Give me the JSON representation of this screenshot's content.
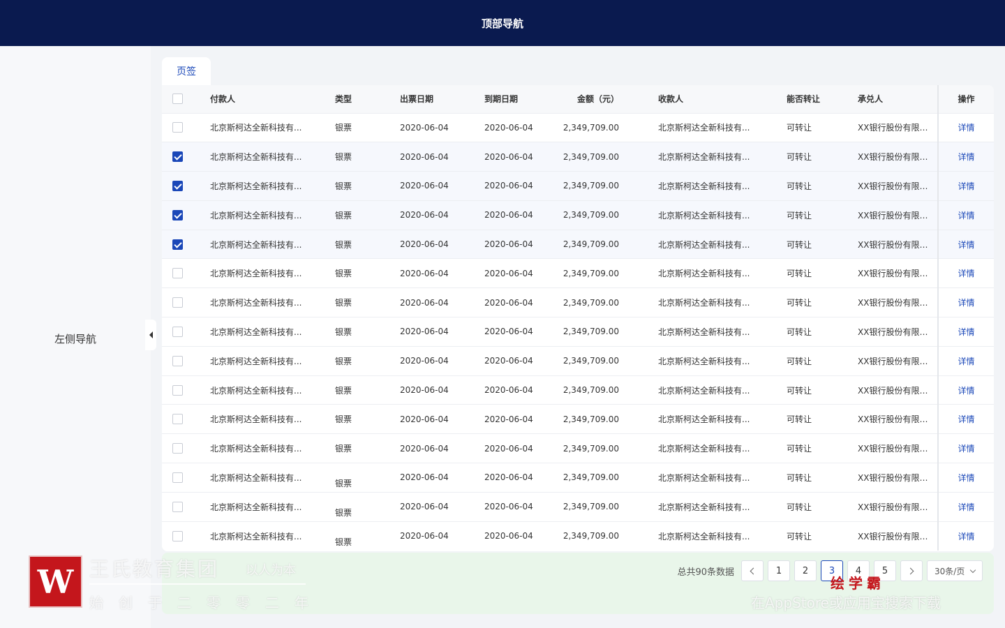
{
  "top_nav": {
    "title": "顶部导航"
  },
  "sidebar": {
    "title": "左侧导航"
  },
  "tab": {
    "label": "页签"
  },
  "table": {
    "headers": {
      "payer": "付款人",
      "type": "类型",
      "issue_date": "出票日期",
      "due_date": "到期日期",
      "amount": "金额（元）",
      "payee": "收款人",
      "transferable": "能否转让",
      "acceptor": "承兑人",
      "operation": "操作"
    },
    "rows": [
      {
        "checked": false,
        "payer": "北京斯柯达全新科技有...",
        "type": "银票",
        "issue_date": "2020-06-04",
        "due_date": "2020-06-04",
        "amount": "2,349,709.00",
        "payee": "北京斯柯达全新科技有...",
        "transferable": "可转让",
        "acceptor": "XX银行股份有限公司...",
        "action": "详情"
      },
      {
        "checked": true,
        "payer": "北京斯柯达全新科技有...",
        "type": "银票",
        "issue_date": "2020-06-04",
        "due_date": "2020-06-04",
        "amount": "2,349,709.00",
        "payee": "北京斯柯达全新科技有...",
        "transferable": "可转让",
        "acceptor": "XX银行股份有限公司...",
        "action": "详情"
      },
      {
        "checked": true,
        "payer": "北京斯柯达全新科技有...",
        "type": "银票",
        "issue_date": "2020-06-04",
        "due_date": "2020-06-04",
        "amount": "2,349,709.00",
        "payee": "北京斯柯达全新科技有...",
        "transferable": "可转让",
        "acceptor": "XX银行股份有限公司...",
        "action": "详情"
      },
      {
        "checked": true,
        "payer": "北京斯柯达全新科技有...",
        "type": "银票",
        "issue_date": "2020-06-04",
        "due_date": "2020-06-04",
        "amount": "2,349,709.00",
        "payee": "北京斯柯达全新科技有...",
        "transferable": "可转让",
        "acceptor": "XX银行股份有限公司...",
        "action": "详情"
      },
      {
        "checked": true,
        "payer": "北京斯柯达全新科技有...",
        "type": "银票",
        "issue_date": "2020-06-04",
        "due_date": "2020-06-04",
        "amount": "2,349,709.00",
        "payee": "北京斯柯达全新科技有...",
        "transferable": "可转让",
        "acceptor": "XX银行股份有限公司...",
        "action": "详情"
      },
      {
        "checked": false,
        "payer": "北京斯柯达全新科技有...",
        "type": "银票",
        "issue_date": "2020-06-04",
        "due_date": "2020-06-04",
        "amount": "2,349,709.00",
        "payee": "北京斯柯达全新科技有...",
        "transferable": "可转让",
        "acceptor": "XX银行股份有限公司...",
        "action": "详情"
      },
      {
        "checked": false,
        "payer": "北京斯柯达全新科技有...",
        "type": "银票",
        "issue_date": "2020-06-04",
        "due_date": "2020-06-04",
        "amount": "2,349,709.00",
        "payee": "北京斯柯达全新科技有...",
        "transferable": "可转让",
        "acceptor": "XX银行股份有限公司...",
        "action": "详情"
      },
      {
        "checked": false,
        "payer": "北京斯柯达全新科技有...",
        "type": "银票",
        "issue_date": "2020-06-04",
        "due_date": "2020-06-04",
        "amount": "2,349,709.00",
        "payee": "北京斯柯达全新科技有...",
        "transferable": "可转让",
        "acceptor": "XX银行股份有限公司...",
        "action": "详情"
      },
      {
        "checked": false,
        "payer": "北京斯柯达全新科技有...",
        "type": "银票",
        "issue_date": "2020-06-04",
        "due_date": "2020-06-04",
        "amount": "2,349,709.00",
        "payee": "北京斯柯达全新科技有...",
        "transferable": "可转让",
        "acceptor": "XX银行股份有限公司...",
        "action": "详情"
      },
      {
        "checked": false,
        "payer": "北京斯柯达全新科技有...",
        "type": "银票",
        "issue_date": "2020-06-04",
        "due_date": "2020-06-04",
        "amount": "2,349,709.00",
        "payee": "北京斯柯达全新科技有...",
        "transferable": "可转让",
        "acceptor": "XX银行股份有限公司...",
        "action": "详情"
      },
      {
        "checked": false,
        "payer": "北京斯柯达全新科技有...",
        "type": "银票",
        "issue_date": "2020-06-04",
        "due_date": "2020-06-04",
        "amount": "2,349,709.00",
        "payee": "北京斯柯达全新科技有...",
        "transferable": "可转让",
        "acceptor": "XX银行股份有限公司...",
        "action": "详情"
      },
      {
        "checked": false,
        "payer": "北京斯柯达全新科技有...",
        "type": "银票",
        "issue_date": "2020-06-04",
        "due_date": "2020-06-04",
        "amount": "2,349,709.00",
        "payee": "北京斯柯达全新科技有...",
        "transferable": "可转让",
        "acceptor": "XX银行股份有限公司...",
        "action": "详情"
      },
      {
        "checked": false,
        "payer": "北京斯柯达全新科技有...",
        "type": "银票",
        "issue_date": "2020-06-04",
        "due_date": "2020-06-04",
        "amount": "2,349,709.00",
        "payee": "北京斯柯达全新科技有...",
        "transferable": "可转让",
        "acceptor": "XX银行股份有限公司...",
        "action": "详情"
      },
      {
        "checked": false,
        "payer": "北京斯柯达全新科技有...",
        "type": "银票",
        "issue_date": "2020-06-04",
        "due_date": "2020-06-04",
        "amount": "2,349,709.00",
        "payee": "北京斯柯达全新科技有...",
        "transferable": "可转让",
        "acceptor": "XX银行股份有限公司...",
        "action": "详情"
      },
      {
        "checked": false,
        "payer": "北京斯柯达全新科技有...",
        "type": "银票",
        "issue_date": "2020-06-04",
        "due_date": "2020-06-04",
        "amount": "2,349,709.00",
        "payee": "北京斯柯达全新科技有...",
        "transferable": "可转让",
        "acceptor": "XX银行股份有限公司...",
        "action": "详情"
      }
    ]
  },
  "pagination": {
    "total_text": "总共90条数据",
    "pages": [
      "1",
      "2",
      "3",
      "4",
      "5"
    ],
    "current_page": "3",
    "page_size": "30条/页"
  },
  "watermark": {
    "org_name": "王氏教育集团",
    "slogan": "以人为本",
    "subtitle": "始创于二零零二年",
    "brand": "绘学霸",
    "appstore_text": "在AppStore或应用宝搜索下载"
  },
  "colors": {
    "topnav_bg": "#0a1a4f",
    "accent": "#1a47b8"
  }
}
